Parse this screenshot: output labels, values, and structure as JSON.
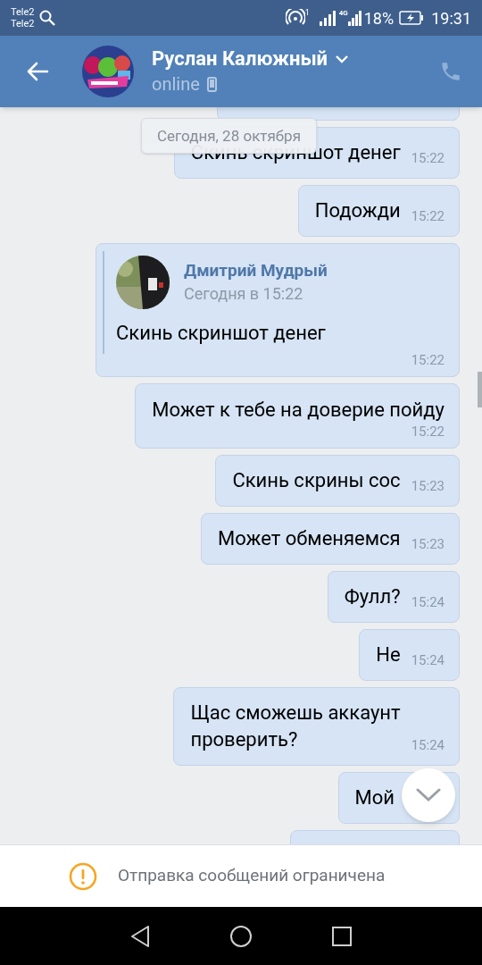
{
  "status_bar": {
    "carriers": [
      "Tele2",
      "Tele2"
    ],
    "hotspot_count": "1",
    "network": "4G",
    "battery": "18%",
    "time": "19:31"
  },
  "header": {
    "name": "Руслан Калюжный",
    "status": "online"
  },
  "date_pill": "Сегодня, 28 октября",
  "messages": [
    {
      "kind": "short",
      "text": "Скинь скриншот денег",
      "time": "15:22"
    },
    {
      "kind": "short",
      "text": "Подожди",
      "time": "15:22"
    },
    {
      "kind": "forward",
      "author": "Дмитрий Мудрый",
      "date": "Сегодня в 15:22",
      "text": "Скинь скриншот денег",
      "time": "15:22"
    },
    {
      "kind": "long",
      "text": "Может к тебе на доверие пойду",
      "time": "15:22"
    },
    {
      "kind": "short",
      "text": "Скинь скрины сос",
      "time": "15:23"
    },
    {
      "kind": "short",
      "text": "Может обменяемся",
      "time": "15:23"
    },
    {
      "kind": "short",
      "text": "Фулл?",
      "time": "15:24"
    },
    {
      "kind": "short",
      "text": "Не",
      "time": "15:24"
    },
    {
      "kind": "short",
      "text": "Щас сможешь аккаунт\nпроверить?",
      "time": "15:24"
    },
    {
      "kind": "short",
      "text": "Мой"
    }
  ],
  "notice": "Отправка сообщений ограничена"
}
